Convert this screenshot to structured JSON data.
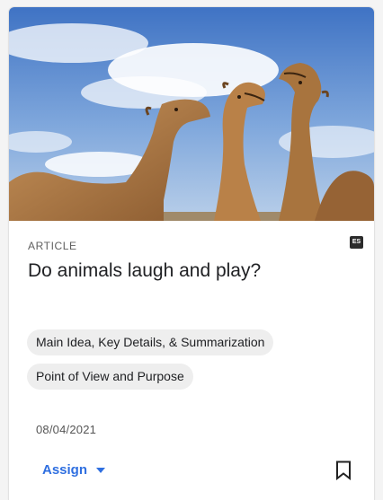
{
  "card": {
    "image_alt": "Three camels with heads raised against a blue sky",
    "type_label": "ARTICLE",
    "language_badge": "ES",
    "title": "Do animals laugh and play?",
    "tags": [
      "Main Idea, Key Details, & Summarization",
      "Point of View and Purpose"
    ],
    "date": "08/04/2021",
    "assign_label": "Assign"
  },
  "icons": {
    "assign_dropdown": "caret-down-icon",
    "bookmark": "bookmark-icon"
  },
  "colors": {
    "accent": "#2f6fe0",
    "chip_bg": "#eeeeee",
    "badge_bg": "#2b2b2b"
  }
}
